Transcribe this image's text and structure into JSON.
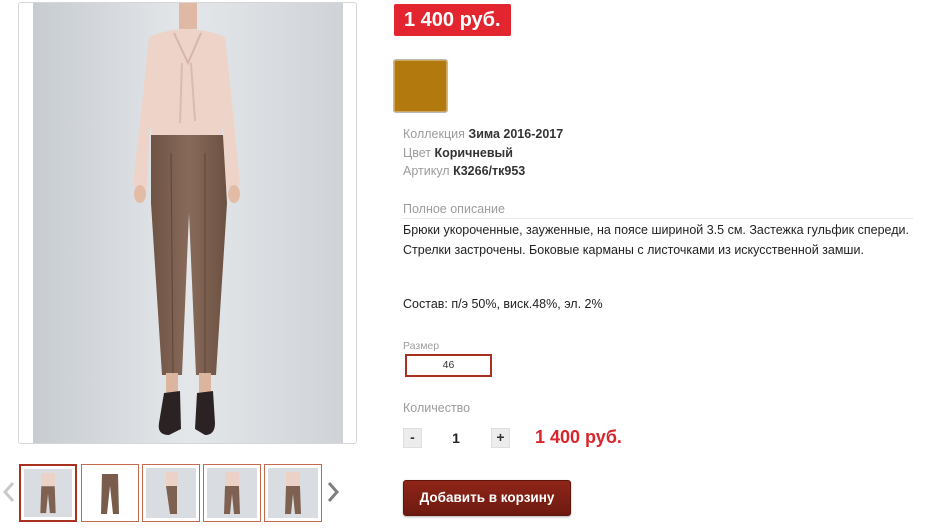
{
  "product": {
    "price": "1 400 руб.",
    "color_hex": "#b2790e",
    "collection_label": "Коллекция",
    "collection_value": "Зима 2016-2017",
    "color_label": "Цвет",
    "color_value": "Коричневый",
    "sku_label": "Артикул",
    "sku_value": "К3266/тк953",
    "description_title": "Полное описание",
    "description_text": "Брюки укороченные, зауженные, на поясе шириной 3.5 см. Застежка гульфик спереди. Стрелки застрочены. Боковые карманы с листочками из искусственной замши.",
    "composition": "Состав: п/э 50%, виск.48%, эл. 2%",
    "size_label": "Размер",
    "size_value": "46",
    "quantity_label": "Количество",
    "quantity_value": "1",
    "minus_label": "-",
    "plus_label": "+",
    "total_price": "1 400 руб.",
    "add_to_cart_label": "Добавить в корзину"
  },
  "icons": {
    "prev": "chevron-left-icon",
    "next": "chevron-right-icon"
  }
}
